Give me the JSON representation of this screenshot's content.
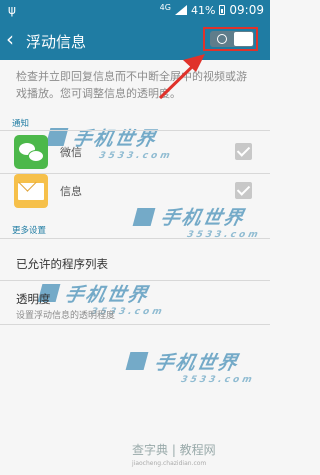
{
  "status_bar": {
    "network": "4G",
    "battery_percent": "41%",
    "time": "09:09"
  },
  "action_bar": {
    "title": "浮动信息",
    "back_icon": "chevron-left-icon",
    "toggle_state": "off"
  },
  "description": "检查并立即回复信息而不中断全屏中的视频或游戏播放。您可调整信息的透明度。",
  "notification_section": {
    "header": "通知",
    "apps": [
      {
        "label": "微信",
        "icon": "wechat-icon",
        "checked": true
      },
      {
        "label": "信息",
        "icon": "message-icon",
        "checked": true
      }
    ]
  },
  "more_settings": {
    "header": "更多设置",
    "allowed_list": "已允许的程序列表",
    "transparency_title": "透明度",
    "transparency_desc": "设置浮动信息的透明程度"
  },
  "watermarks": {
    "brand": "手机世界",
    "number": "3533.com",
    "bottom_text": "查字典 | 教程网",
    "bottom_url": "jiaocheng.chazidian.com"
  },
  "colors": {
    "accent": "#1f7ca3",
    "highlight": "#e0322b"
  }
}
